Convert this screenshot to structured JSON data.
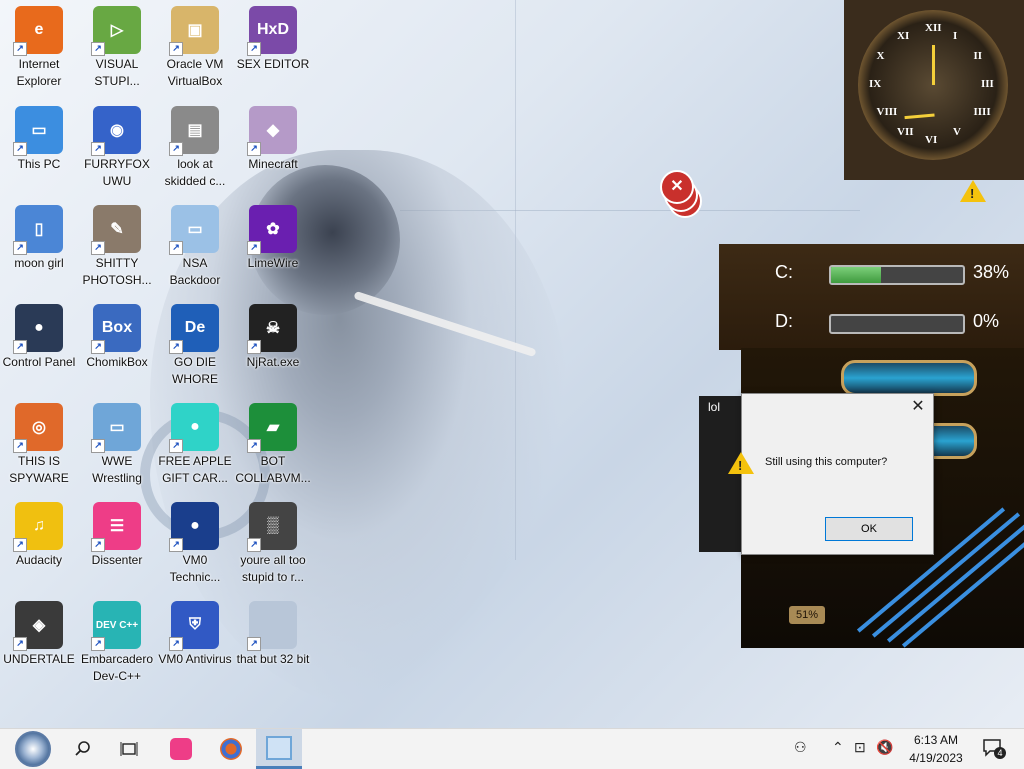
{
  "desktop": {
    "icons": [
      {
        "id": "internet-explorer",
        "label": "Internet Explorer",
        "color": "#e86a1c",
        "glyph": "e"
      },
      {
        "id": "visual-studio",
        "label": "VISUAL STUPI...",
        "color": "#68a843",
        "glyph": "▷"
      },
      {
        "id": "virtualbox",
        "label": "Oracle VM VirtualBox",
        "color": "#d8b56a",
        "glyph": "▣"
      },
      {
        "id": "hxd",
        "label": "SEX EDITOR",
        "color": "#7b4aa8",
        "glyph": "HxD"
      },
      {
        "id": "this-pc",
        "label": "This PC",
        "color": "#3c8ee0",
        "glyph": "▭"
      },
      {
        "id": "firefox",
        "label": "FURRYFOX UWU",
        "color": "#3563c9",
        "glyph": "◉"
      },
      {
        "id": "look-at-skidded",
        "label": "look at skidded c...",
        "color": "#8a8a8a",
        "glyph": "▤"
      },
      {
        "id": "minecraft",
        "label": "Minecraft",
        "color": "#b59ac8",
        "glyph": "◆"
      },
      {
        "id": "moon-girl",
        "label": "moon girl",
        "color": "#4b86d6",
        "glyph": "▯"
      },
      {
        "id": "gimp",
        "label": "SHITTY PHOTOSH...",
        "color": "#8a7a6a",
        "glyph": "✎"
      },
      {
        "id": "nsa-backdoor",
        "label": "NSA Backdoor",
        "color": "#9bc1e6",
        "glyph": "▭"
      },
      {
        "id": "limewire",
        "label": "LimeWire",
        "color": "#6a1fb0",
        "glyph": "✿"
      },
      {
        "id": "control-panel",
        "label": "Control Panel",
        "color": "#2a3a56",
        "glyph": "●"
      },
      {
        "id": "chomikbox",
        "label": "ChomikBox",
        "color": "#3a6ac0",
        "glyph": "Box"
      },
      {
        "id": "go-die-whore",
        "label": "GO DIE WHORE",
        "color": "#1f5fb8",
        "glyph": "De"
      },
      {
        "id": "njrat",
        "label": "NjRat.exe",
        "color": "#222222",
        "glyph": "☠"
      },
      {
        "id": "this-is-spyware",
        "label": "THIS IS SPYWARE",
        "color": "#e0692a",
        "glyph": "◎"
      },
      {
        "id": "wwe-wrestling",
        "label": "WWE Wrestling",
        "color": "#6fa6d8",
        "glyph": "▭"
      },
      {
        "id": "free-apple-gift-card",
        "label": "FREE APPLE GIFT CAR...",
        "color": "#2fd3c8",
        "glyph": "●"
      },
      {
        "id": "bot-collabvm",
        "label": "BOT COLLABVM...",
        "color": "#1d8f3a",
        "glyph": "▰"
      },
      {
        "id": "audacity",
        "label": "Audacity",
        "color": "#f0c010",
        "glyph": "♫"
      },
      {
        "id": "dissenter",
        "label": "Dissenter",
        "color": "#ee3d87",
        "glyph": "☰"
      },
      {
        "id": "vm0-technic",
        "label": "VM0 Technic...",
        "color": "#1a3e8c",
        "glyph": "●"
      },
      {
        "id": "youre-all-too-stupid",
        "label": "youre all too stupid to r...",
        "color": "#444444",
        "glyph": "▒"
      },
      {
        "id": "undertale",
        "label": "UNDERTALE",
        "color": "#3a3a3a",
        "glyph": "◈"
      },
      {
        "id": "embarcadero-devcpp",
        "label": "Embarcadero Dev-C++",
        "color": "#28b4b4",
        "glyph": "DEV C++"
      },
      {
        "id": "vm0-antivirus",
        "label": "VM0 Antivirus",
        "color": "#3159c4",
        "glyph": "⛨"
      },
      {
        "id": "that-but-32-bit",
        "label": "that but 32 bit",
        "color": "#b8c6d8",
        "glyph": ""
      }
    ]
  },
  "clock_gadget": {
    "numerals": [
      "XII",
      "I",
      "II",
      "III",
      "IIII",
      "V",
      "VI",
      "VII",
      "VIII",
      "IX",
      "X",
      "XI"
    ]
  },
  "drive_gadget": {
    "drives": [
      {
        "letter": "C:",
        "percent": "38%",
        "fill": 0.38
      },
      {
        "letter": "D:",
        "percent": "0%",
        "fill": 0.0
      }
    ]
  },
  "steam_gadget": {
    "gauge_label": "51%"
  },
  "dialog": {
    "back_title": "lol",
    "message": "Still using this computer?",
    "ok_label": "OK",
    "close_glyph": "✕"
  },
  "taskbar": {
    "time": "6:13 AM",
    "date": "4/19/2023",
    "notification_count": "4"
  }
}
